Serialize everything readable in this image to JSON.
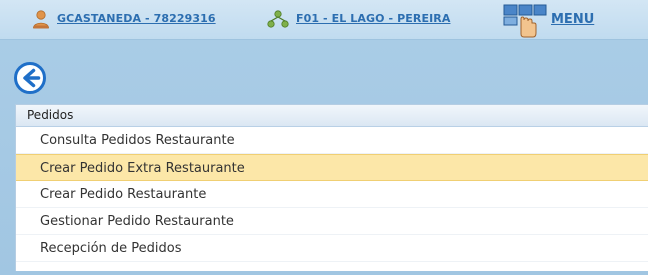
{
  "header": {
    "user_label": "GCASTANEDA - 78229316",
    "branch_label": "F01 - EL LAGO - PEREIRA",
    "menu_label": "MENU"
  },
  "icons": {
    "user": "user-icon",
    "branch": "network-icon",
    "menu": "menu-hand-icon",
    "back": "back-arrow-icon"
  },
  "panel": {
    "title": "Pedidos",
    "items": [
      {
        "label": "Consulta Pedidos Restaurante",
        "selected": false
      },
      {
        "label": "Crear Pedido Extra Restaurante",
        "selected": true
      },
      {
        "label": "Crear Pedido Restaurante",
        "selected": false
      },
      {
        "label": "Gestionar Pedido Restaurante",
        "selected": false
      },
      {
        "label": "Recepción de Pedidos",
        "selected": false
      }
    ]
  },
  "colors": {
    "background": "#a9cce6",
    "link": "#2c6eb0",
    "selected_row": "#fce7a8",
    "accent_blue": "#1f6fc8"
  }
}
